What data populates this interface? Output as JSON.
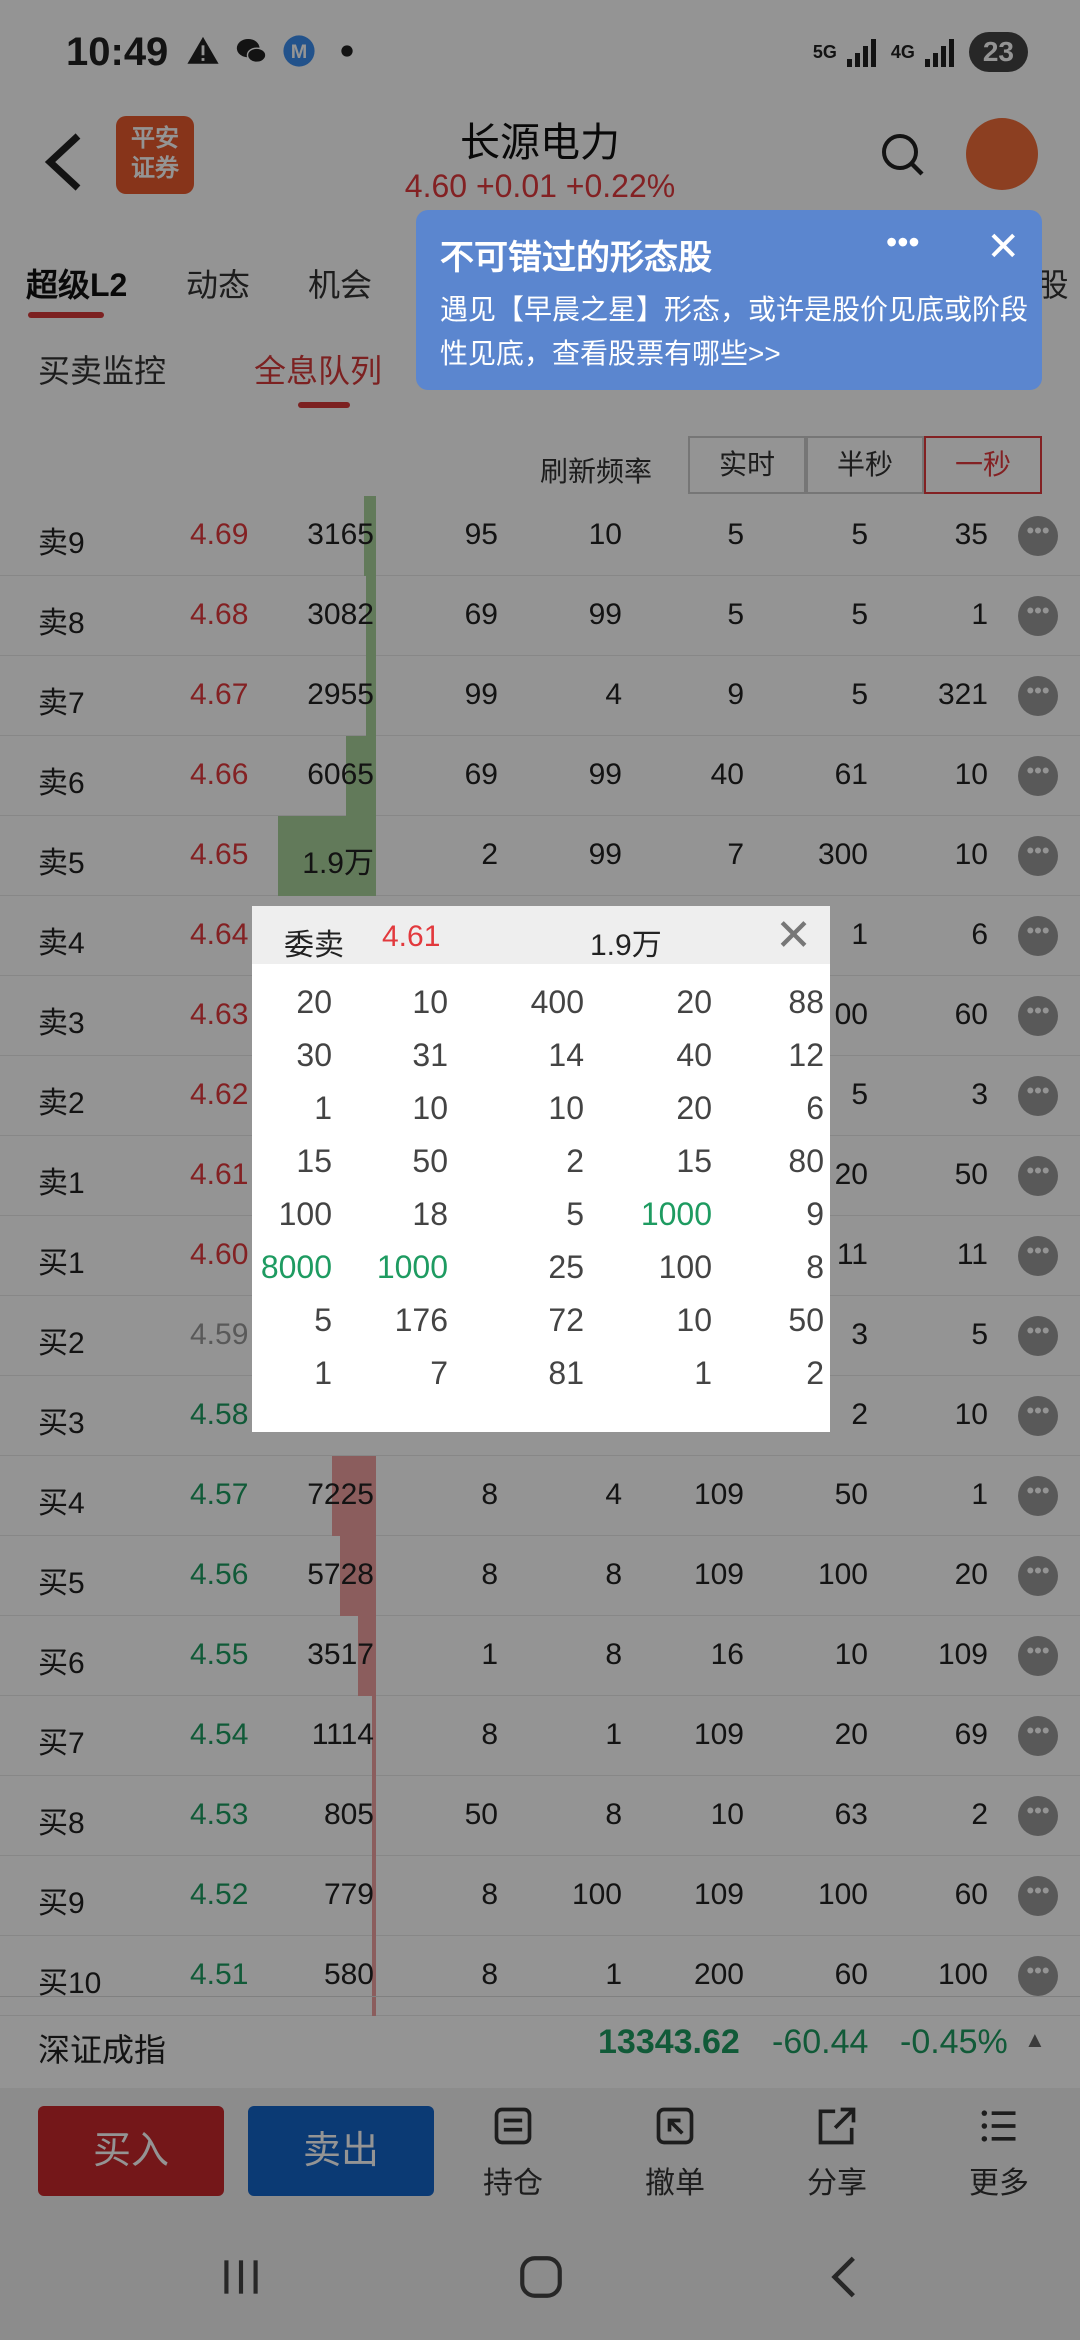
{
  "status": {
    "time": "10:49",
    "net1": "5G",
    "net2": "4G",
    "battery": "23"
  },
  "header": {
    "brand": "平安\n证券",
    "brand_line1": "平安",
    "brand_line2": "证券",
    "title": "长源电力",
    "quote": "4.60  +0.01  +0.22%"
  },
  "tabs": [
    "超级L2",
    "动态",
    "机会",
    "...",
    "...",
    "...",
    "...",
    "...股"
  ],
  "subtabs": {
    "monitor": "买卖监控",
    "queue": "全息队列"
  },
  "refresh": {
    "label": "刷新频率",
    "options": [
      "实时",
      "半秒",
      "一秒"
    ],
    "active": "一秒"
  },
  "rows": [
    {
      "label": "卖9",
      "price": "4.69",
      "vol": "3165",
      "a": "95",
      "b": "10",
      "c": "5",
      "d": "5",
      "e": "35"
    },
    {
      "label": "卖8",
      "price": "4.68",
      "vol": "3082",
      "a": "69",
      "b": "99",
      "c": "5",
      "d": "5",
      "e": "1"
    },
    {
      "label": "卖7",
      "price": "4.67",
      "vol": "2955",
      "a": "99",
      "b": "4",
      "c": "9",
      "d": "5",
      "e": "321"
    },
    {
      "label": "卖6",
      "price": "4.66",
      "vol": "6065",
      "a": "69",
      "b": "99",
      "c": "40",
      "d": "61",
      "e": "10"
    },
    {
      "label": "卖5",
      "price": "4.65",
      "vol": "1.9万",
      "a": "2",
      "b": "99",
      "c": "7",
      "d": "300",
      "e": "10"
    },
    {
      "label": "卖4",
      "price": "4.64",
      "vol": "",
      "a": "",
      "b": "",
      "c": "",
      "d": "1",
      "e": "6"
    },
    {
      "label": "卖3",
      "price": "4.63",
      "vol": "",
      "a": "",
      "b": "",
      "c": "",
      "d": "00",
      "e": "60"
    },
    {
      "label": "卖2",
      "price": "4.62",
      "vol": "",
      "a": "",
      "b": "",
      "c": "",
      "d": "5",
      "e": "3"
    },
    {
      "label": "卖1",
      "price": "4.61",
      "vol": "",
      "a": "",
      "b": "",
      "c": "",
      "d": "20",
      "e": "50"
    },
    {
      "label": "买1",
      "price": "4.60",
      "vol": "",
      "a": "",
      "b": "",
      "c": "",
      "d": "11",
      "e": "11"
    },
    {
      "label": "买2",
      "price": "4.59",
      "vol": "",
      "a": "",
      "b": "",
      "c": "",
      "d": "3",
      "e": "5"
    },
    {
      "label": "买3",
      "price": "4.58",
      "vol": "",
      "a": "",
      "b": "",
      "c": "",
      "d": "2",
      "e": "10"
    },
    {
      "label": "买4",
      "price": "4.57",
      "vol": "7225",
      "a": "8",
      "b": "4",
      "c": "109",
      "d": "50",
      "e": "1"
    },
    {
      "label": "买5",
      "price": "4.56",
      "vol": "5728",
      "a": "8",
      "b": "8",
      "c": "109",
      "d": "100",
      "e": "20"
    },
    {
      "label": "买6",
      "price": "4.55",
      "vol": "3517",
      "a": "1",
      "b": "8",
      "c": "16",
      "d": "10",
      "e": "109"
    },
    {
      "label": "买7",
      "price": "4.54",
      "vol": "1114",
      "a": "8",
      "b": "1",
      "c": "109",
      "d": "20",
      "e": "69"
    },
    {
      "label": "买8",
      "price": "4.53",
      "vol": "805",
      "a": "50",
      "b": "8",
      "c": "10",
      "d": "63",
      "e": "2"
    },
    {
      "label": "买9",
      "price": "4.52",
      "vol": "779",
      "a": "8",
      "b": "100",
      "c": "109",
      "d": "100",
      "e": "60"
    },
    {
      "label": "买10",
      "price": "4.51",
      "vol": "580",
      "a": "8",
      "b": "1",
      "c": "200",
      "d": "60",
      "e": "100"
    }
  ],
  "banner": {
    "title": "不可错过的形态股",
    "text": "遇见【早晨之星】形态，或许是股价见底或阶段性见底，查看股票有哪些>>",
    "dots": "•••",
    "close": "✕"
  },
  "modal": {
    "label": "委卖",
    "price": "4.61",
    "vol": "1.9万",
    "close": "✕",
    "grid": [
      [
        "20",
        "10",
        "400",
        "20",
        "88"
      ],
      [
        "30",
        "31",
        "14",
        "40",
        "12"
      ],
      [
        "1",
        "10",
        "10",
        "20",
        "6"
      ],
      [
        "15",
        "50",
        "2",
        "15",
        "80"
      ],
      [
        "100",
        "18",
        "5",
        "1000",
        "9"
      ],
      [
        "8000",
        "1000",
        "25",
        "100",
        "8"
      ],
      [
        "5",
        "176",
        "72",
        "10",
        "50"
      ],
      [
        "1",
        "7",
        "81",
        "1",
        "2"
      ]
    ]
  },
  "index": {
    "name": "深证成指",
    "value": "13343.62",
    "change": "-60.44",
    "pct": "-0.45%",
    "arrow": "▲"
  },
  "toolbar": {
    "buy": "买入",
    "sell": "卖出",
    "tools": [
      {
        "label": "持仓",
        "icon": "position-icon"
      },
      {
        "label": "撤单",
        "icon": "cancel-order-icon"
      },
      {
        "label": "分享",
        "icon": "share-icon"
      },
      {
        "label": "更多",
        "icon": "more-menu-icon"
      }
    ]
  },
  "colors": {
    "red": "#e2393d",
    "green": "#1e9b61",
    "buy_btn": "#c8282b",
    "sell_btn": "#1464c8",
    "banner": "#5b86cf"
  }
}
